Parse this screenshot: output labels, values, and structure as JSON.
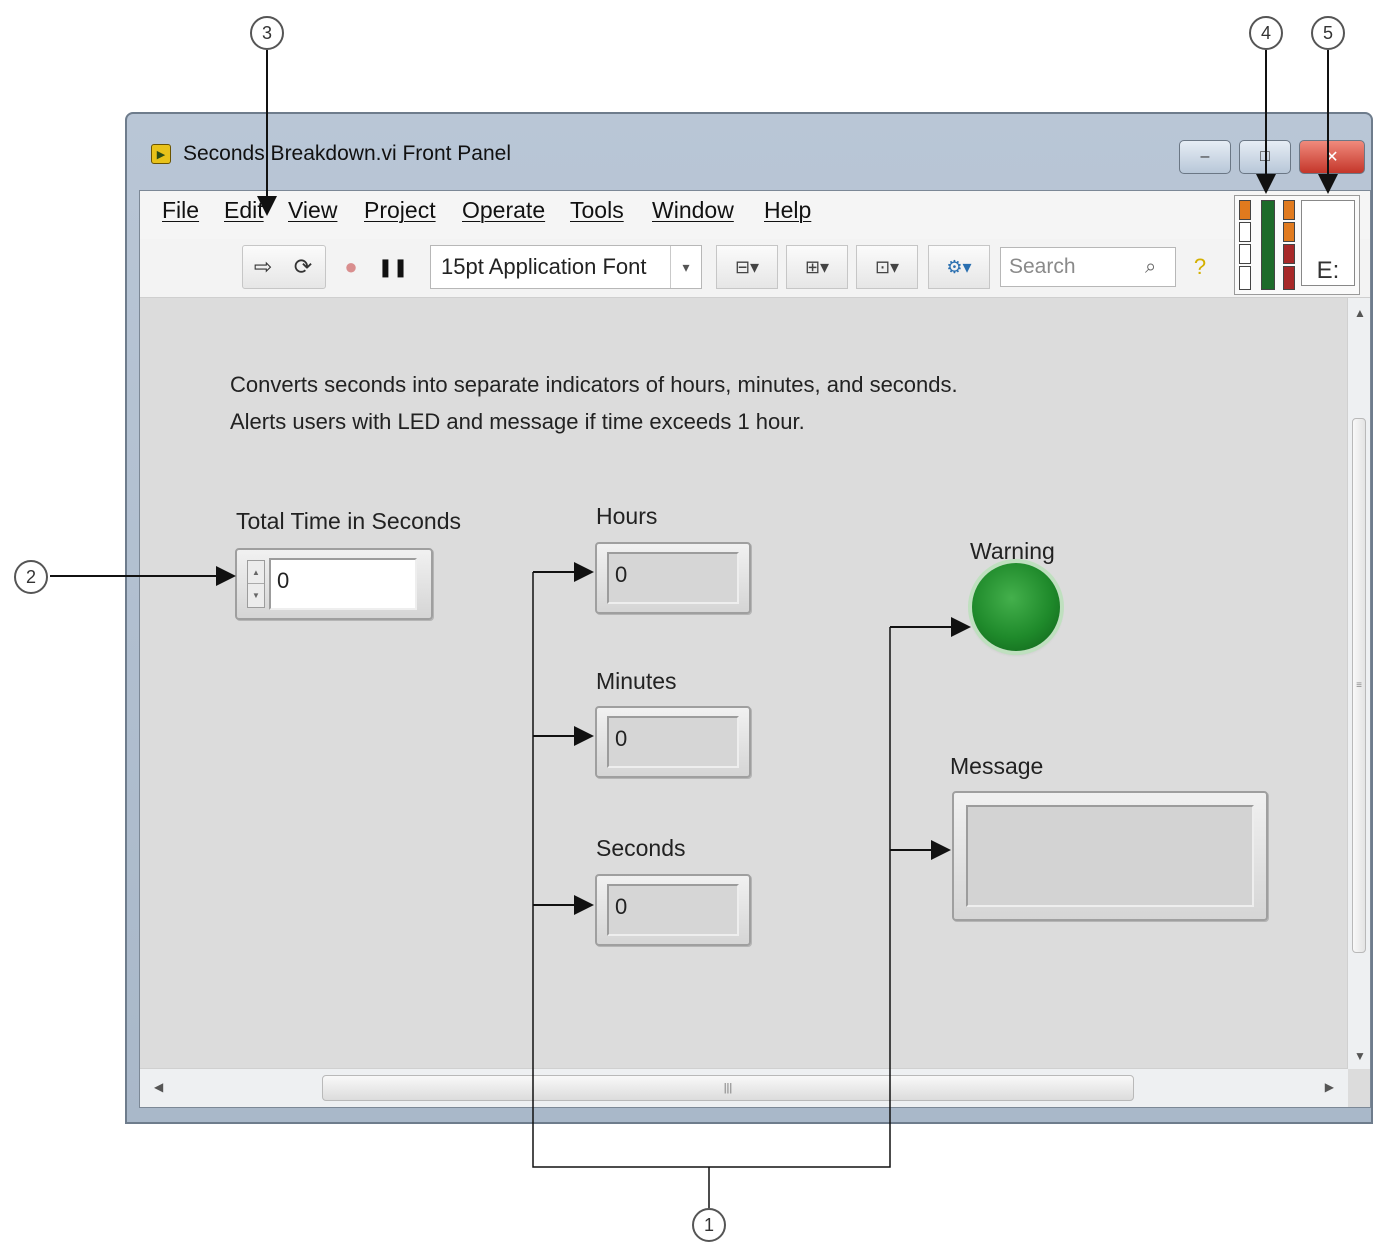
{
  "callouts": [
    "1",
    "2",
    "3",
    "4",
    "5"
  ],
  "window": {
    "title": "Seconds Breakdown.vi Front Panel",
    "app_icon": "labview-vi-icon",
    "buttons": {
      "minimize": "–",
      "restore": "□",
      "close": "✕"
    }
  },
  "menu": [
    "File",
    "Edit",
    "View",
    "Project",
    "Operate",
    "Tools",
    "Window",
    "Help"
  ],
  "toolbar": {
    "run": "⇨",
    "run_continuous": "⟳",
    "abort": "●",
    "pause": "❚❚",
    "font": "15pt Application Font",
    "font_arrow": "▾",
    "align": "⊟▾",
    "distribute": "⊞▾",
    "resize": "⊡▾",
    "reorder": "⚙▾",
    "search_placeholder": "Search",
    "search_icon": "⌕",
    "context_help": "?"
  },
  "icon_pane": {
    "vi_icon_glyph": "E:"
  },
  "panel": {
    "description_line1": "Converts seconds into separate indicators of hours, minutes, and seconds.",
    "description_line2": "Alerts users with LED and message if time exceeds 1 hour.",
    "total_time": {
      "label": "Total Time in Seconds",
      "value": "0"
    },
    "hours": {
      "label": "Hours",
      "value": "0"
    },
    "minutes": {
      "label": "Minutes",
      "value": "0"
    },
    "seconds": {
      "label": "Seconds",
      "value": "0"
    },
    "warning": {
      "label": "Warning",
      "state": "on",
      "color": "#1f8a2b"
    },
    "message": {
      "label": "Message",
      "value": ""
    },
    "hscroll_grip": "|||",
    "vscroll_grip": "≡"
  }
}
